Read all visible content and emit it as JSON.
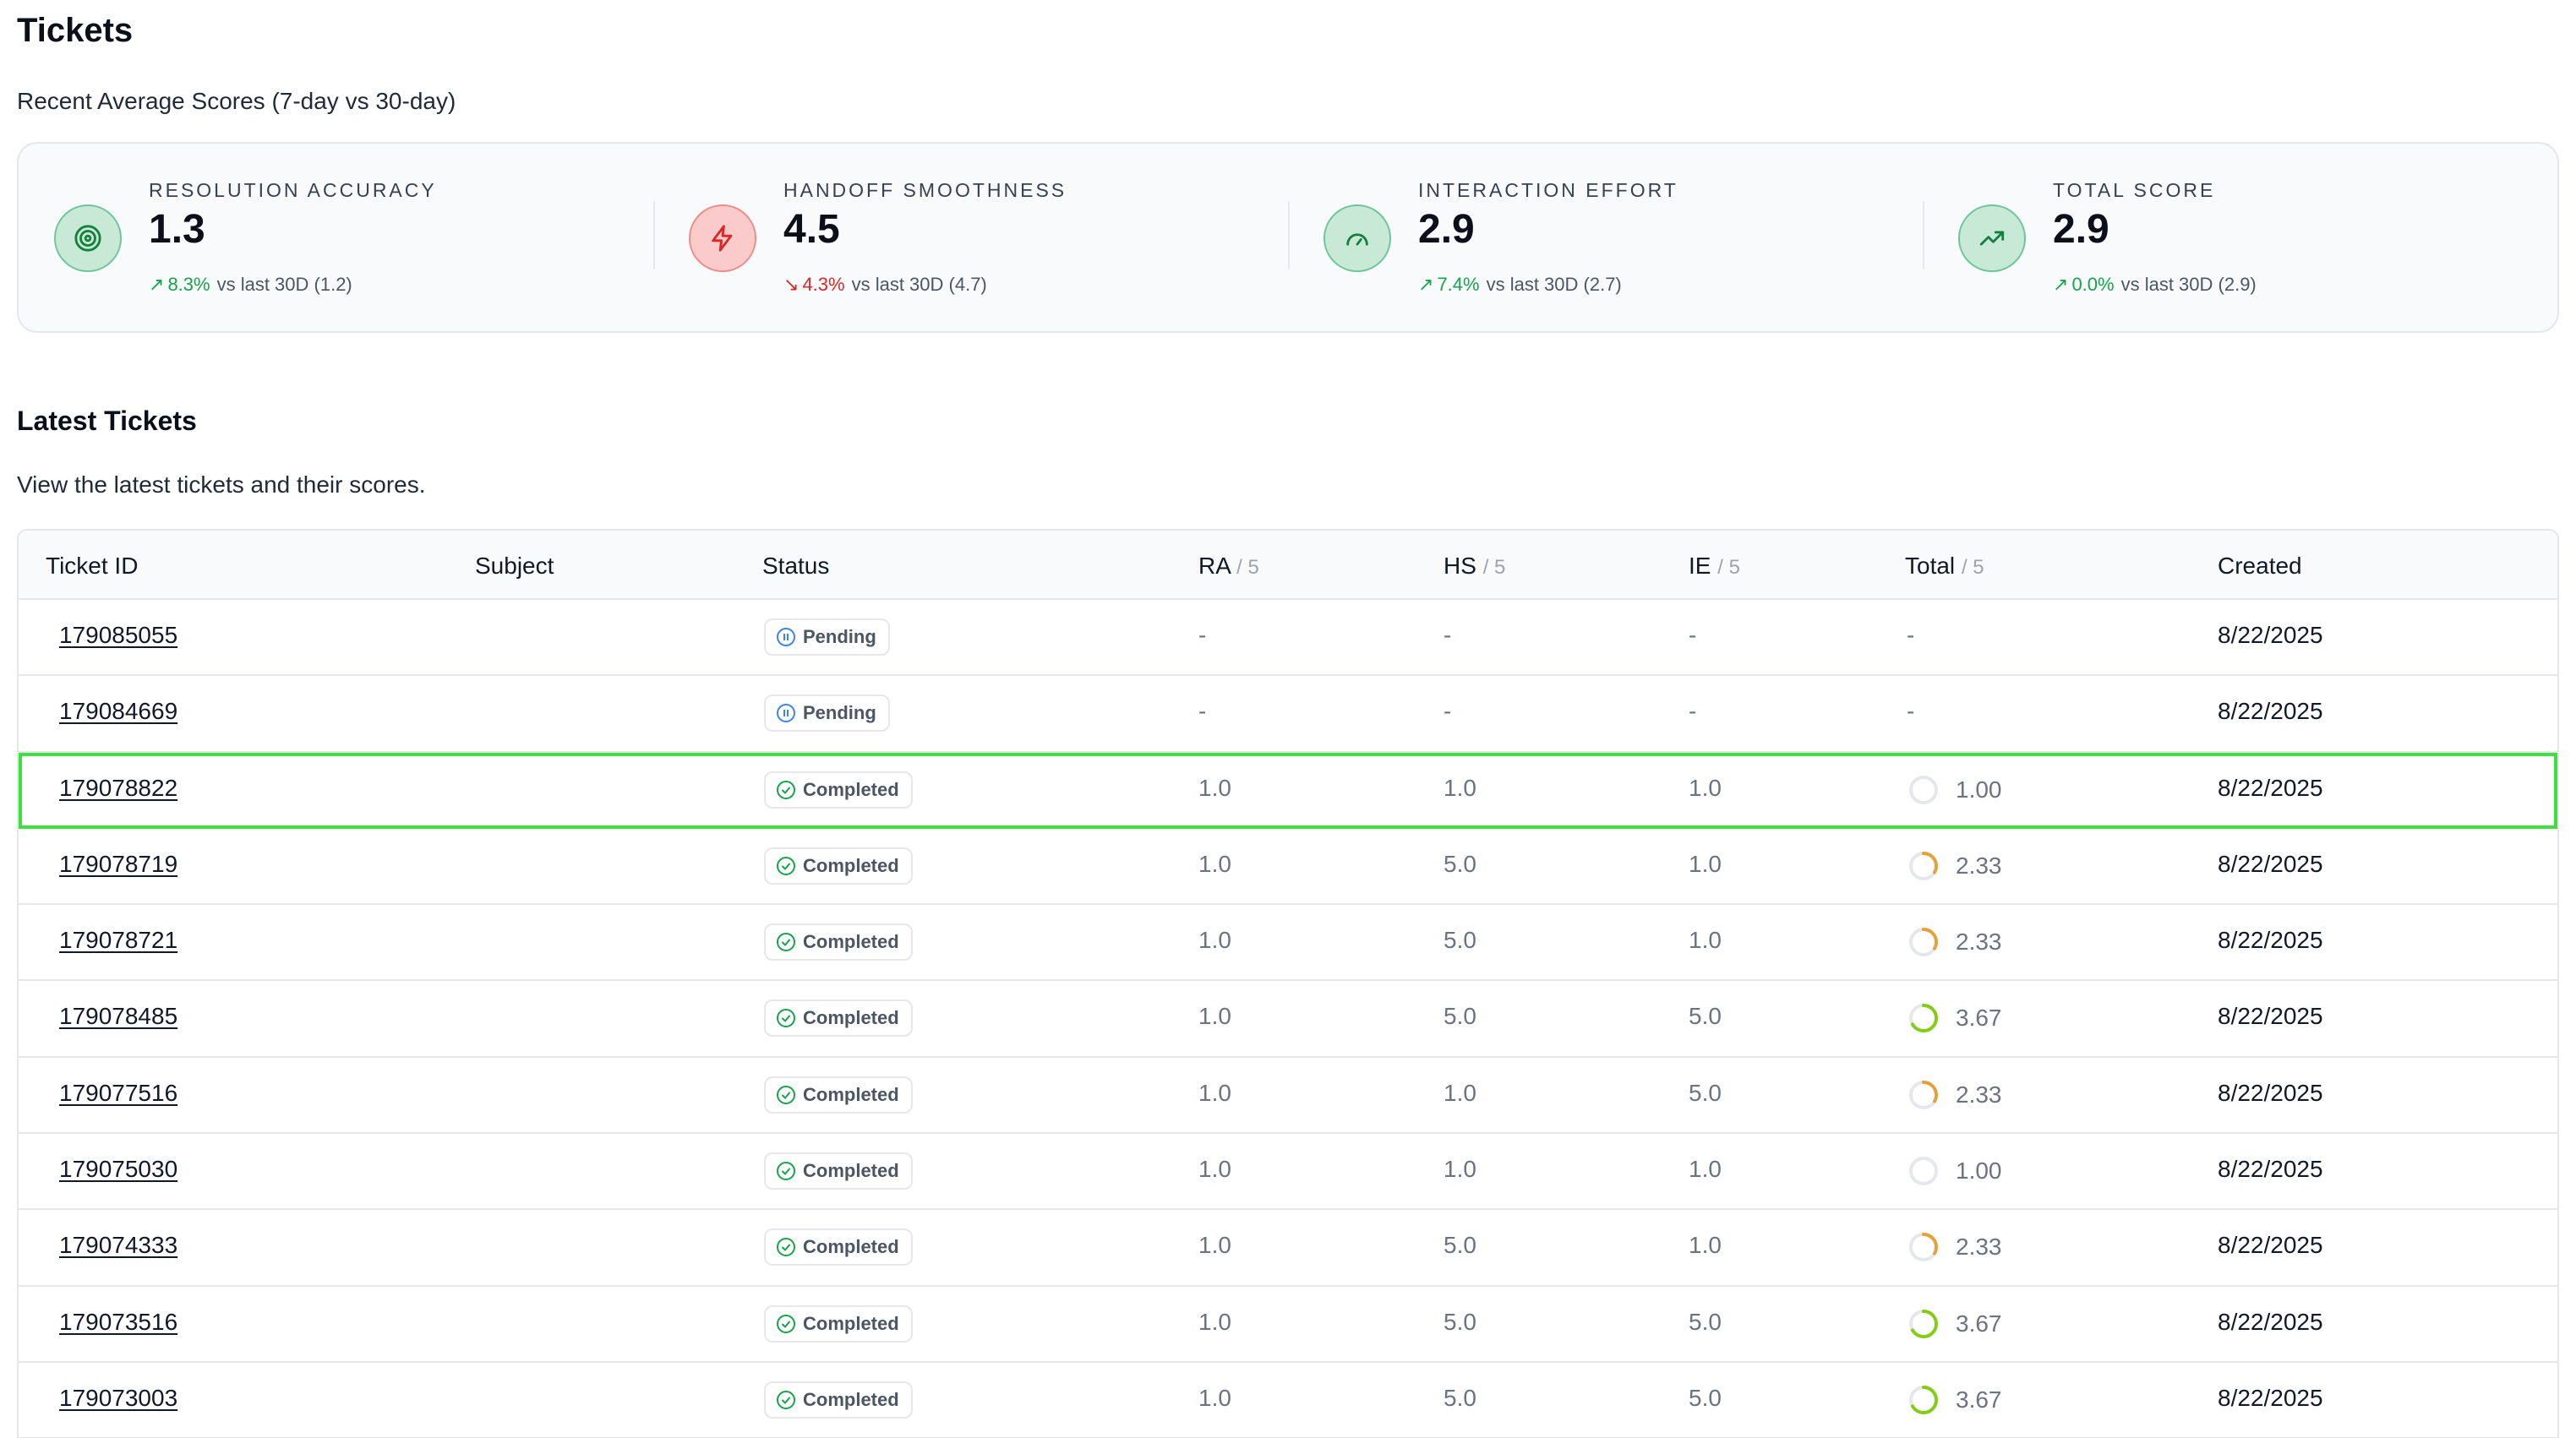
{
  "page": {
    "title": "Tickets",
    "subtitle": "Recent Average Scores (7-day vs 30-day)"
  },
  "stats": [
    {
      "label": "RESOLUTION ACCURACY",
      "value": "1.3",
      "direction": "up",
      "delta": "8.3%",
      "compare": "vs last 30D (1.2)",
      "icon": "target-icon",
      "tone": "green"
    },
    {
      "label": "HANDOFF SMOOTHNESS",
      "value": "4.5",
      "direction": "down",
      "delta": "4.3%",
      "compare": "vs last 30D (4.7)",
      "icon": "lightning-icon",
      "tone": "red"
    },
    {
      "label": "INTERACTION EFFORT",
      "value": "2.9",
      "direction": "up",
      "delta": "7.4%",
      "compare": "vs last 30D (2.7)",
      "icon": "gauge-icon",
      "tone": "green"
    },
    {
      "label": "TOTAL SCORE",
      "value": "2.9",
      "direction": "up",
      "delta": "0.0%",
      "compare": "vs last 30D (2.9)",
      "icon": "trending-up-icon",
      "tone": "green"
    }
  ],
  "latest": {
    "title": "Latest Tickets",
    "description": "View the latest tickets and their scores."
  },
  "table": {
    "headers": {
      "ticket_id": "Ticket ID",
      "subject": "Subject",
      "status": "Status",
      "ra": "RA",
      "hs": "HS",
      "ie": "IE",
      "total": "Total",
      "denominator": "/ 5",
      "created": "Created"
    },
    "rows": [
      {
        "id": "179085055",
        "subject": "",
        "status": "Pending",
        "ra": "-",
        "hs": "-",
        "ie": "-",
        "total": "-",
        "score": null,
        "created": "8/22/2025"
      },
      {
        "id": "179084669",
        "subject": "",
        "status": "Pending",
        "ra": "-",
        "hs": "-",
        "ie": "-",
        "total": "-",
        "score": null,
        "created": "8/22/2025"
      },
      {
        "id": "179078822",
        "subject": "",
        "status": "Completed",
        "ra": "1.0",
        "hs": "1.0",
        "ie": "1.0",
        "total": "1.00",
        "score": 1.0,
        "created": "8/22/2025",
        "selected": true
      },
      {
        "id": "179078719",
        "subject": "",
        "status": "Completed",
        "ra": "1.0",
        "hs": "5.0",
        "ie": "1.0",
        "total": "2.33",
        "score": 2.33,
        "created": "8/22/2025"
      },
      {
        "id": "179078721",
        "subject": "",
        "status": "Completed",
        "ra": "1.0",
        "hs": "5.0",
        "ie": "1.0",
        "total": "2.33",
        "score": 2.33,
        "created": "8/22/2025"
      },
      {
        "id": "179078485",
        "subject": "",
        "status": "Completed",
        "ra": "1.0",
        "hs": "5.0",
        "ie": "5.0",
        "total": "3.67",
        "score": 3.67,
        "created": "8/22/2025"
      },
      {
        "id": "179077516",
        "subject": "",
        "status": "Completed",
        "ra": "1.0",
        "hs": "1.0",
        "ie": "5.0",
        "total": "2.33",
        "score": 2.33,
        "created": "8/22/2025"
      },
      {
        "id": "179075030",
        "subject": "",
        "status": "Completed",
        "ra": "1.0",
        "hs": "1.0",
        "ie": "1.0",
        "total": "1.00",
        "score": 1.0,
        "created": "8/22/2025"
      },
      {
        "id": "179074333",
        "subject": "",
        "status": "Completed",
        "ra": "1.0",
        "hs": "5.0",
        "ie": "1.0",
        "total": "2.33",
        "score": 2.33,
        "created": "8/22/2025"
      },
      {
        "id": "179073516",
        "subject": "",
        "status": "Completed",
        "ra": "1.0",
        "hs": "5.0",
        "ie": "5.0",
        "total": "3.67",
        "score": 3.67,
        "created": "8/22/2025"
      },
      {
        "id": "179073003",
        "subject": "",
        "status": "Completed",
        "ra": "1.0",
        "hs": "5.0",
        "ie": "5.0",
        "total": "3.67",
        "score": 3.67,
        "created": "8/22/2025"
      }
    ]
  },
  "colors": {
    "up": "#16a34a",
    "down": "#dc2626",
    "ring_low": "#e5a23a",
    "ring_high": "#84cc16",
    "ring_track": "#e5e7eb",
    "pending": "#3b82f6",
    "completed": "#16a34a",
    "selected_outline": "#3ee03e"
  }
}
